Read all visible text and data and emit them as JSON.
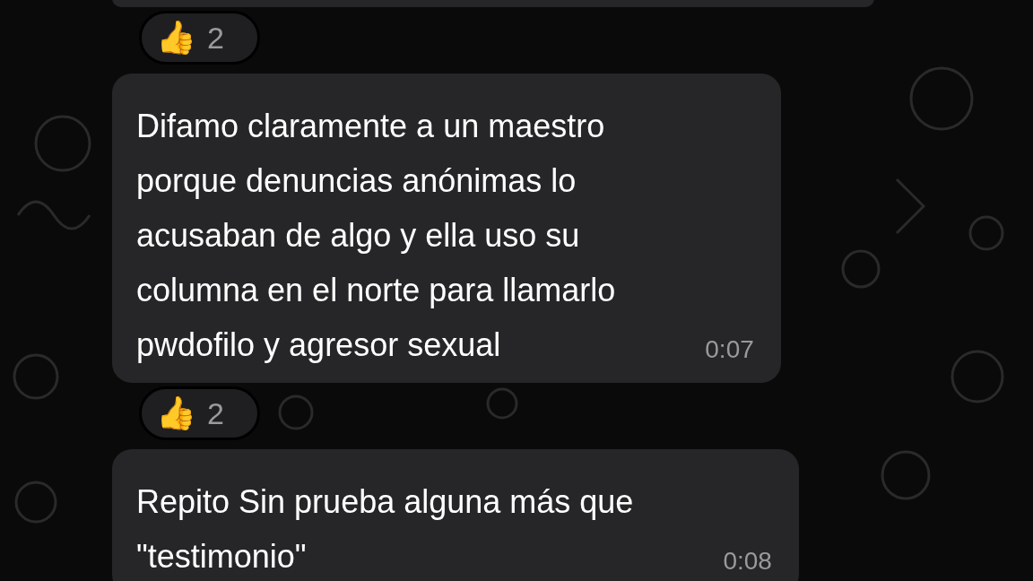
{
  "messages": [
    {
      "reaction": {
        "emoji": "👍",
        "count": "2"
      }
    },
    {
      "lines": [
        "Difamo claramente a un maestro",
        "porque denuncias anónimas lo",
        "acusaban de algo y ella uso su",
        "columna en el norte para llamarlo",
        "pwdofilo y agresor sexual"
      ],
      "time": "0:07",
      "reaction": {
        "emoji": "👍",
        "count": "2"
      }
    },
    {
      "lines": [
        "Repito Sin prueba alguna más que",
        "\"testimonio\""
      ],
      "time": "0:08"
    }
  ]
}
